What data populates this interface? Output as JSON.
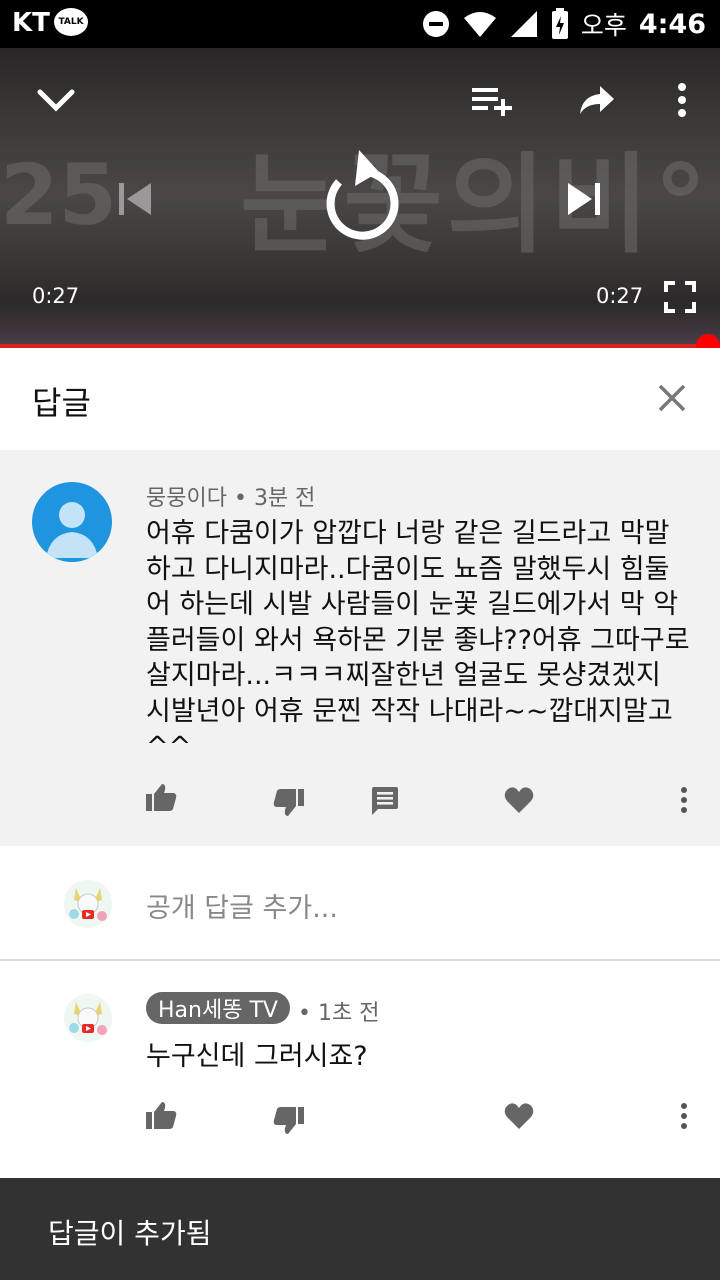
{
  "status_bar": {
    "carrier": "KT",
    "talk_badge": "TALK",
    "ampm": "오후",
    "time": "4:46"
  },
  "player": {
    "background_text": "눈꽃의비°",
    "background_number": "25",
    "time_elapsed": "0:27",
    "time_total": "0:27",
    "progress_fraction": 1.0,
    "icons": [
      "chevron-down-icon",
      "add-to-playlist-icon",
      "share-icon",
      "more-vert-icon",
      "previous-icon",
      "replay-icon",
      "next-icon",
      "fullscreen-icon"
    ]
  },
  "reply_header": {
    "title": "답글"
  },
  "main_comment": {
    "author": "뭉뭉이다",
    "time": "3분 전",
    "text": "어휴 다쿰이가 압깝다 너랑 같은 길드라고 막말하고 다니지마라..다쿰이도 뇨즘 말했두시 힘둘어 하는데 시발 사람들이 눈꽃 길드에가서 막 악플러들이 와서 욕하몬 기분 좋냐??어휴 그따구로 살지마라...ㅋㅋㅋ찌잘한년 얼굴도 못샹겼겠지 시발년아 어휴 문찐 작작 나대라~~깝대지말고^^"
  },
  "add_reply": {
    "placeholder": "공개 답글 추가..."
  },
  "reply": {
    "author": "Han세똥 TV",
    "time": "1초 전",
    "text": "누구신데 그러시죠?"
  },
  "toast": {
    "message": "답글이 추가됨"
  },
  "colors": {
    "progress": "#ff0000",
    "avatar_blue": "#1f95e0",
    "toast_bg": "#323232",
    "comment_bg": "#f2f2f2"
  }
}
